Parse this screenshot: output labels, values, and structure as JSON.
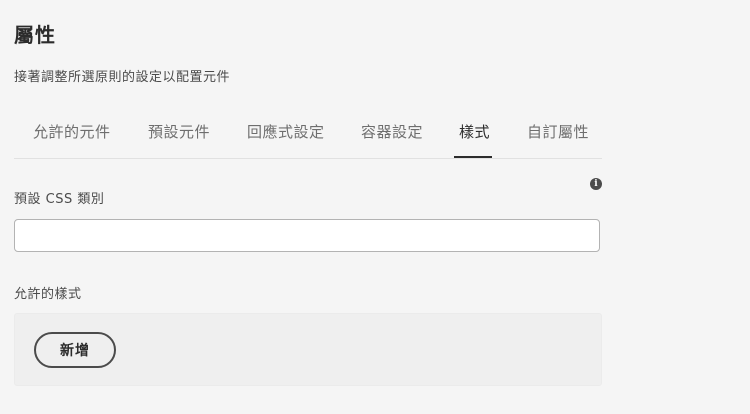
{
  "page": {
    "title": "屬性",
    "subtitle": "接著調整所選原則的設定以配置元件"
  },
  "tabs": [
    {
      "label": "允許的元件",
      "selected": false
    },
    {
      "label": "預設元件",
      "selected": false
    },
    {
      "label": "回應式設定",
      "selected": false
    },
    {
      "label": "容器設定",
      "selected": false
    },
    {
      "label": "樣式",
      "selected": true
    },
    {
      "label": "自訂屬性",
      "selected": false
    }
  ],
  "css_class_field": {
    "label": "預設 CSS 類別",
    "value": "",
    "info_icon": "info-icon"
  },
  "allowed_styles": {
    "label": "允許的樣式",
    "add_button_label": "新增"
  },
  "colors": {
    "background": "#f5f5f5",
    "text": "#2c2c2c",
    "tab_inactive": "#6e6e6e",
    "input_border": "#b3b3b3"
  }
}
